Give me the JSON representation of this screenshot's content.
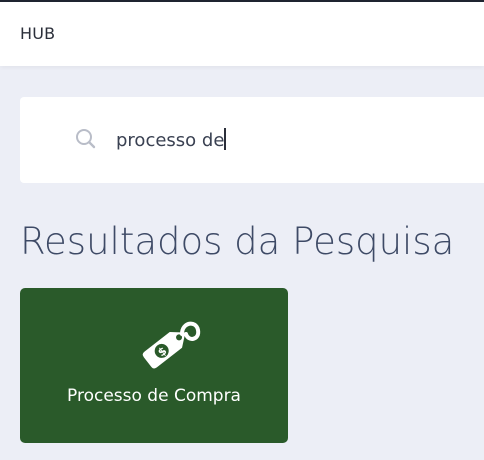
{
  "header": {
    "brand": "HUB"
  },
  "search": {
    "query": "processo de",
    "icon": "search-icon"
  },
  "results": {
    "title": "Resultados da Pesquisa",
    "items": [
      {
        "label": "Processo de Compra",
        "icon": "price-tag-dollar-icon",
        "color": "#2a5a2a"
      }
    ]
  },
  "colors": {
    "background": "#eceef6",
    "header_bg": "#ffffff",
    "title_text": "#3e4a66",
    "card_bg": "#2a5a2a"
  }
}
